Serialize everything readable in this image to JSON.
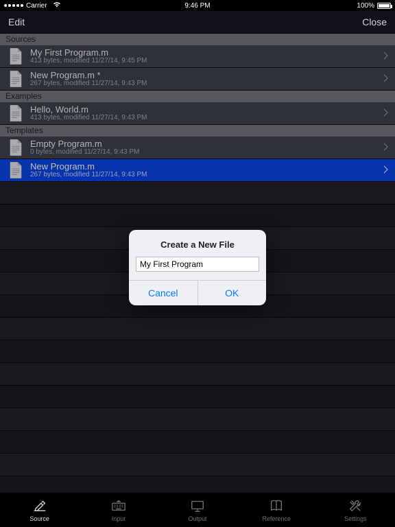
{
  "status": {
    "carrier": "Carrier",
    "time": "9:46 PM",
    "battery_pct": "100%"
  },
  "navbar": {
    "edit": "Edit",
    "close": "Close"
  },
  "sections": [
    {
      "header": "Sources",
      "rows": [
        {
          "title": "My First Program.m",
          "meta": "413 bytes, modified 11/27/14, 9:45 PM",
          "selected": false
        },
        {
          "title": "New Program.m *",
          "meta": "267 bytes, modified 11/27/14, 9:43 PM",
          "selected": false
        }
      ]
    },
    {
      "header": "Examples",
      "rows": [
        {
          "title": "Hello, World.m",
          "meta": "413 bytes, modified 11/27/14, 9:43 PM",
          "selected": false
        }
      ]
    },
    {
      "header": "Templates",
      "rows": [
        {
          "title": "Empty Program.m",
          "meta": "0 bytes, modified 11/27/14, 9:43 PM",
          "selected": false
        },
        {
          "title": "New Program.m",
          "meta": "267 bytes, modified 11/27/14, 9:43 PM",
          "selected": true
        }
      ]
    }
  ],
  "dialog": {
    "title": "Create a New File",
    "value": "My First Program",
    "cancel": "Cancel",
    "ok": "OK"
  },
  "tabs": [
    {
      "label": "Source",
      "icon": "pen",
      "active": true
    },
    {
      "label": "Input",
      "icon": "keyboard",
      "active": false
    },
    {
      "label": "Output",
      "icon": "monitor",
      "active": false
    },
    {
      "label": "Reference",
      "icon": "book",
      "active": false
    },
    {
      "label": "Settings",
      "icon": "tools",
      "active": false
    }
  ]
}
